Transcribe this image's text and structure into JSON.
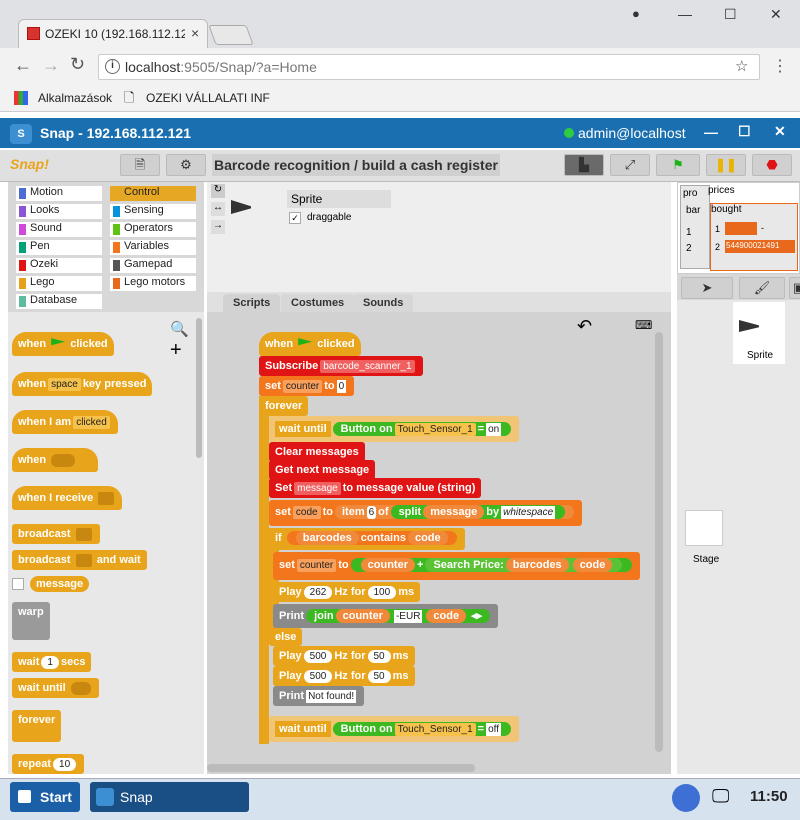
{
  "browser": {
    "tab_title": "OZEKI 10 (192.168.112.12",
    "url_host": "localhost",
    "url_rest": ":9505/Snap/?a=Home",
    "bookmarks": [
      "Alkalmazások",
      "OZEKI VÁLLALATI INF"
    ]
  },
  "snap": {
    "window_title": "Snap - 192.168.112.121",
    "user": "admin@localhost",
    "logo": "Snap!",
    "project_title": "Barcode recognition / build a cash register",
    "categories": [
      {
        "label": "Motion",
        "color": "#4a6cd4"
      },
      {
        "label": "Control",
        "color": "#e6a822"
      },
      {
        "label": "Looks",
        "color": "#8a55d7"
      },
      {
        "label": "Sensing",
        "color": "#0494dc"
      },
      {
        "label": "Sound",
        "color": "#cf4ad9"
      },
      {
        "label": "Operators",
        "color": "#62c213"
      },
      {
        "label": "Pen",
        "color": "#00a178"
      },
      {
        "label": "Variables",
        "color": "#f3761d"
      },
      {
        "label": "Ozeki",
        "color": "#e01414"
      },
      {
        "label": "Gamepad",
        "color": "#555555"
      },
      {
        "label": "Lego",
        "color": "#e8a01c"
      },
      {
        "label": "Lego motors",
        "color": "#e8691c"
      },
      {
        "label": "Database",
        "color": "#5fbca0"
      }
    ],
    "palette": {
      "when_flag": [
        "when",
        "clicked"
      ],
      "when_key": [
        "when",
        "space",
        "key pressed"
      ],
      "when_i_am": [
        "when I am",
        "clicked"
      ],
      "when": "when",
      "when_receive": "when I receive",
      "broadcast": "broadcast",
      "broadcast_wait": [
        "broadcast",
        "and wait"
      ],
      "message": "message",
      "warp": "warp",
      "wait": [
        "wait",
        "1",
        "secs"
      ],
      "wait_until": "wait until",
      "forever": "forever",
      "repeat": [
        "repeat",
        "10"
      ]
    },
    "sprite": {
      "name": "Sprite",
      "draggable": "draggable"
    },
    "tabs": [
      "Scripts",
      "Costumes",
      "Sounds"
    ],
    "script": {
      "hat": [
        "when",
        "clicked"
      ],
      "subscribe": [
        "Subscribe",
        "barcode_scanner_1"
      ],
      "set_counter": [
        "set",
        "counter",
        "to",
        "0"
      ],
      "forever": "forever",
      "wait_until1": [
        "wait until",
        "Button on",
        "Touch_Sensor_1",
        "=",
        "on"
      ],
      "clear": "Clear messages",
      "get_next": "Get next message",
      "set_msg": [
        "Set",
        "message",
        "to message value (string)"
      ],
      "set_code": [
        "set",
        "code",
        "to",
        "item",
        "6",
        "of",
        "split",
        "message",
        "by",
        "whitespace"
      ],
      "if": [
        "if",
        "barcodes",
        "contains",
        "code"
      ],
      "set_counter2": [
        "set",
        "counter",
        "to",
        "counter",
        "+",
        "Search Price:",
        "barcodes",
        "code"
      ],
      "play1": [
        "Play",
        "262",
        "Hz for",
        "100",
        "ms"
      ],
      "print1": [
        "Print",
        "join",
        "counter",
        "-EUR",
        "code"
      ],
      "else": "else",
      "play2": [
        "Play",
        "500",
        "Hz for",
        "50",
        "ms"
      ],
      "play3": [
        "Play",
        "500",
        "Hz for",
        "50",
        "ms"
      ],
      "print2": [
        "Print",
        "Not found!"
      ],
      "wait_until2": [
        "wait until",
        "Button on",
        "Touch_Sensor_1",
        "=",
        "off"
      ]
    },
    "stage": {
      "watcher1": "pro",
      "watcher2": "prices",
      "watcher3": "bar",
      "watcher4": "bought",
      "rows": [
        "1",
        "2"
      ],
      "values": [
        "-",
        "544900021491"
      ]
    },
    "corral": {
      "sprite_label": "Sprite",
      "stage_label": "Stage"
    }
  },
  "taskbar": {
    "start": "Start",
    "app": "Snap",
    "time": "11:50"
  }
}
